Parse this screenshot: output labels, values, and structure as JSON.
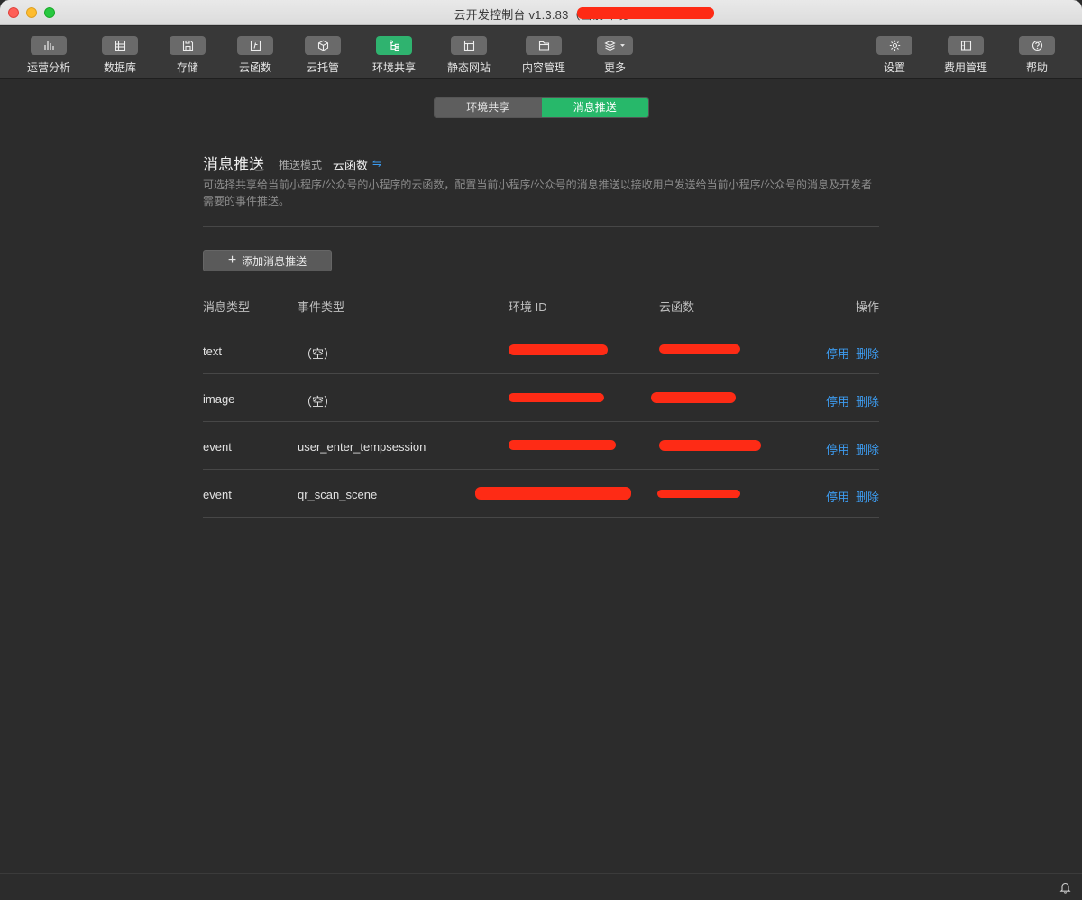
{
  "window": {
    "title": "云开发控制台 v1.3.83（当前环境"
  },
  "toolbar": {
    "items": [
      {
        "label": "运营分析",
        "icon": "bar-chart-icon"
      },
      {
        "label": "数据库",
        "icon": "database-icon"
      },
      {
        "label": "存储",
        "icon": "storage-icon"
      },
      {
        "label": "云函数",
        "icon": "cloud-function-icon"
      },
      {
        "label": "云托管",
        "icon": "box-icon"
      },
      {
        "label": "环境共享",
        "icon": "share-tree-icon",
        "active": true
      },
      {
        "label": "静态网站",
        "icon": "browser-window-icon"
      },
      {
        "label": "内容管理",
        "icon": "folder-icon"
      },
      {
        "label": "更多",
        "icon": "layers-dropdown-icon"
      }
    ],
    "right_items": [
      {
        "label": "设置",
        "icon": "gear-icon"
      },
      {
        "label": "费用管理",
        "icon": "billing-icon"
      },
      {
        "label": "帮助",
        "icon": "help-icon"
      }
    ]
  },
  "segment": {
    "tabs": [
      "环境共享",
      "消息推送"
    ],
    "selected": "消息推送"
  },
  "main": {
    "title": "消息推送",
    "mode_label": "推送模式",
    "mode_value": "云函数",
    "mode_switch_icon": "⇋",
    "description": "可选择共享给当前小程序/公众号的小程序的云函数，配置当前小程序/公众号的消息推送以接收用户发送给当前小程序/公众号的消息及开发者需要的事件推送。",
    "add_button_label": "添加消息推送"
  },
  "table": {
    "headers": [
      "消息类型",
      "事件类型",
      "环境 ID",
      "云函数",
      "操作"
    ],
    "rows": [
      {
        "msg_type": "text",
        "event_type": "（空）",
        "env_id": "",
        "function": ""
      },
      {
        "msg_type": "image",
        "event_type": "（空）",
        "env_id": "",
        "function": ""
      },
      {
        "msg_type": "event",
        "event_type": "user_enter_tempsession",
        "env_id": "",
        "function": ""
      },
      {
        "msg_type": "event",
        "event_type": "qr_scan_scene",
        "env_id": "",
        "function": ""
      }
    ],
    "action_disable": "停用",
    "action_delete": "删除"
  },
  "colors": {
    "accent_green": "#27b86a",
    "link_blue": "#3d9cf0",
    "redaction": "#fe2b15"
  }
}
